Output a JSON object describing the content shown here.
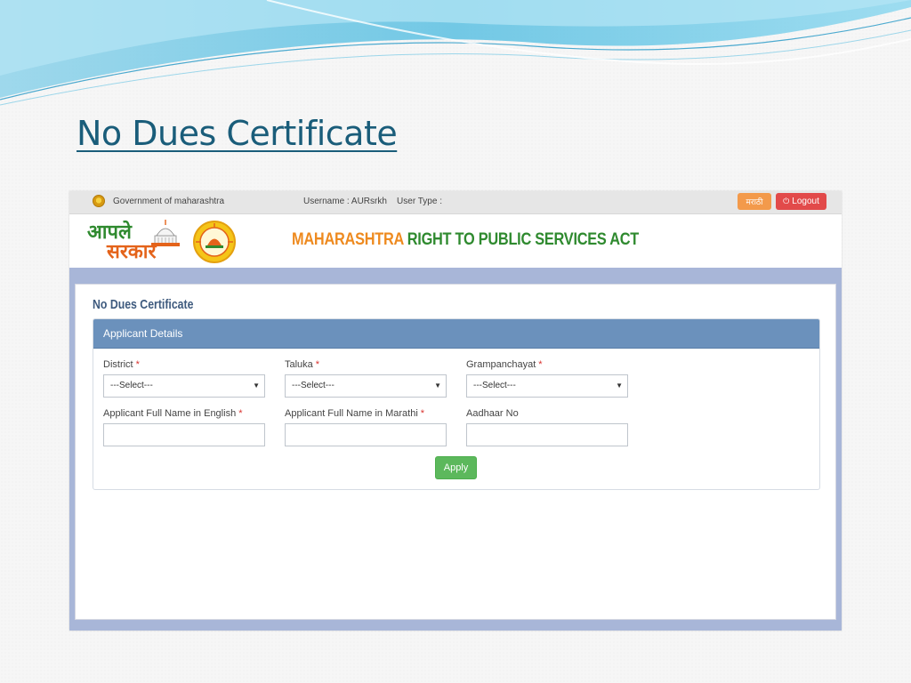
{
  "slide": {
    "title": "No Dues Certificate"
  },
  "topbar": {
    "gov_label": "Government of maharashtra",
    "user_info": "Username : AURsrkh    User Type :",
    "marathi_label": "मराठी",
    "logout_label": "Logout"
  },
  "header": {
    "logo_line1": "आपले",
    "logo_line2": "सरकार",
    "act_title_orange": "MAHARASHTRA",
    "act_title_green": "RIGHT TO PUBLIC SERVICES ACT"
  },
  "form": {
    "heading": "No Dues Certificate",
    "panel_title": "Applicant Details",
    "fields": {
      "district": {
        "label": "District",
        "value": "---Select---"
      },
      "taluka": {
        "label": "Taluka",
        "value": "---Select---"
      },
      "grampanchayat": {
        "label": "Grampanchayat",
        "value": "---Select---"
      },
      "name_english": {
        "label": "Applicant Full Name in English",
        "value": ""
      },
      "name_marathi": {
        "label": "Applicant Full Name in Marathi",
        "value": ""
      },
      "aadhaar": {
        "label": "Aadhaar No",
        "value": ""
      }
    },
    "required_marker": "*",
    "apply_label": "Apply"
  },
  "colors": {
    "title_blue": "#1a5d7a",
    "panel_header": "#6b91bc",
    "apply_green": "#5cb85c",
    "logout_red": "#e24a4a",
    "marathi_orange": "#f39a4b"
  }
}
